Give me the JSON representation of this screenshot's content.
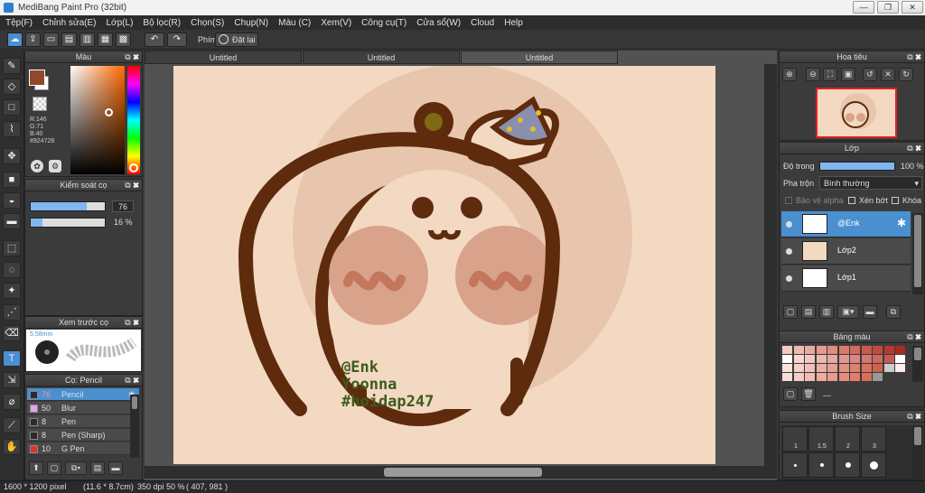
{
  "window": {
    "title": "MediBang Paint Pro (32bit)",
    "minimize": "—",
    "restore": "❐",
    "close": "✕"
  },
  "menu": [
    "Tệp(F)",
    "Chỉnh sửa(E)",
    "Lớp(L)",
    "Bộ lọc(R)",
    "Chọn(S)",
    "Chụp(N)",
    "Màu (C)",
    "Xem(V)",
    "Công cụ(T)",
    "Cửa sổ(W)",
    "Cloud",
    "Help"
  ],
  "toolbar": {
    "undo_icon": "↶",
    "redo_icon": "↷",
    "shortcut_label": "Phím",
    "reset_label": "Đặt lại"
  },
  "tabs": [
    "Untitled",
    "Untitled",
    "Untitled"
  ],
  "color_panel": {
    "title": "Màu",
    "r": "R:146",
    "g": "G:71",
    "b": "B:40",
    "hex": "#924728",
    "primary_color": "#924728"
  },
  "brush_control": {
    "title": "Kiểm soát cọ",
    "size_value": "76",
    "opacity_value": "16 %",
    "size_fraction": 0.76,
    "opacity_fraction": 0.16
  },
  "brush_preview": {
    "title": "Xem trước cọ",
    "size_text": "5.58mm"
  },
  "brush_panel": {
    "title": "Cọ: Pencil",
    "items": [
      {
        "size": "76",
        "name": "Pencil",
        "color": "#2a2a2a"
      },
      {
        "size": "50",
        "name": "Blur",
        "color": "#e8a0e8"
      },
      {
        "size": "8",
        "name": "Pen",
        "color": "#2a2a2a"
      },
      {
        "size": "8",
        "name": "Pen (Sharp)",
        "color": "#2a2a2a"
      },
      {
        "size": "10",
        "name": "G Pen",
        "color": "#e03030"
      }
    ]
  },
  "navigator": {
    "title": "Hoa tiêu"
  },
  "layers": {
    "title": "Lớp",
    "opacity_label": "Độ trong",
    "opacity_value": "100 %",
    "blend_label": "Pha trộn",
    "blend_value": "Bình thường",
    "protect_alpha": "Bảo vệ alpha",
    "clipping": "Xén bớt",
    "lock": "Khóa",
    "items": [
      {
        "name": "@Enk"
      },
      {
        "name": "Lớp2"
      },
      {
        "name": "Lớp1"
      }
    ]
  },
  "palette": {
    "title": "Bảng màu",
    "name": "---"
  },
  "brush_size": {
    "title": "Brush Size",
    "labels": [
      "1",
      "1.5",
      "2",
      "3"
    ]
  },
  "artwork_text": {
    "line1": "@Enk",
    "line2": "Yoonna",
    "line3": "#hoidap247"
  },
  "status": {
    "size": "1600 * 1200 pixel",
    "cm": "(11.6 * 8.7cm)",
    "dpi": "350 dpi",
    "zoom": "50 %",
    "coords": "( 407, 981 )"
  }
}
